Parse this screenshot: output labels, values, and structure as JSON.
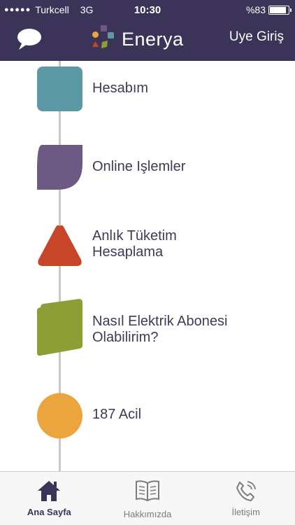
{
  "status_bar": {
    "carrier": "Turkcell",
    "network": "3G",
    "time": "10:30",
    "battery": "%83",
    "battery_level": 0.83
  },
  "header": {
    "logo_text": "Enerya",
    "login_label": "Uye Giriş",
    "bg_color": "#3b3358"
  },
  "menu": {
    "items": [
      {
        "label": "Hesabım",
        "shape": "rounded-square",
        "color": "#5c99a4"
      },
      {
        "label": "Online Işlemler",
        "shape": "leaf",
        "color": "#6c5a84"
      },
      {
        "label": "Anlık Tüketim\nHesaplama",
        "shape": "triangle",
        "color": "#c7462a"
      },
      {
        "label": "Nasıl Elektrik Abonesi\nOlabilirim?",
        "shape": "parallelogram",
        "color": "#8e9e36"
      },
      {
        "label": "187 Acil",
        "shape": "circle",
        "color": "#eba43e"
      }
    ]
  },
  "tabbar": {
    "tabs": [
      {
        "label": "Ana Sayfa",
        "icon": "home-icon",
        "active": true
      },
      {
        "label": "Hakkımızda",
        "icon": "book-icon",
        "active": false
      },
      {
        "label": "İletişim",
        "icon": "phone-icon",
        "active": false
      }
    ]
  }
}
